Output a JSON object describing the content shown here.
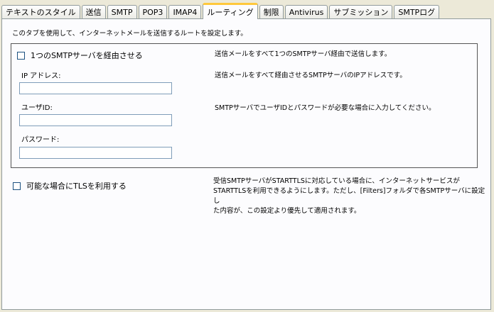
{
  "tabs": [
    {
      "label": "テキストのスタイル",
      "active": false
    },
    {
      "label": "送信",
      "active": false
    },
    {
      "label": "SMTP",
      "active": false
    },
    {
      "label": "POP3",
      "active": false
    },
    {
      "label": "IMAP4",
      "active": false
    },
    {
      "label": "ルーティング",
      "active": true
    },
    {
      "label": "制限",
      "active": false
    },
    {
      "label": "Antivirus",
      "active": false
    },
    {
      "label": "サブミッション",
      "active": false
    },
    {
      "label": "SMTPログ",
      "active": false
    }
  ],
  "intro": "このタブを使用して、インターネットメールを送信するルートを設定します。",
  "smtp_group": {
    "checkbox_label": "1つのSMTPサーバを経由させる",
    "checked": false,
    "checkbox_desc": "送信メールをすべて1つのSMTPサーバ経由で送信します。",
    "ip_label": "IP アドレス:",
    "ip_value": "",
    "ip_desc": "送信メールをすべて経由させるSMTPサーバのIPアドレスです。",
    "user_label": "ユーザID:",
    "user_value": "",
    "user_desc": "SMTPサーバでユーザIDとパスワードが必要な場合に入力してください。",
    "password_label": "パスワード:",
    "password_value": ""
  },
  "tls": {
    "checkbox_label": "可能な場合にTLSを利用する",
    "checked": false,
    "desc_line1": "受信SMTPサーバがSTARTTLSに対応している場合に、インターネットサービスが",
    "desc_line2": "STARTTLSを利用できるようにします。ただし、[Filters]フォルダで各SMTPサーバに設定し",
    "desc_line3": "た内容が、この設定より優先して適用されます。"
  },
  "colors": {
    "active_tab_accent": "#ffc83c",
    "window_bg": "#ece9d8",
    "panel_bg": "#fcfcfe",
    "checkbox_border": "#1c5180"
  }
}
